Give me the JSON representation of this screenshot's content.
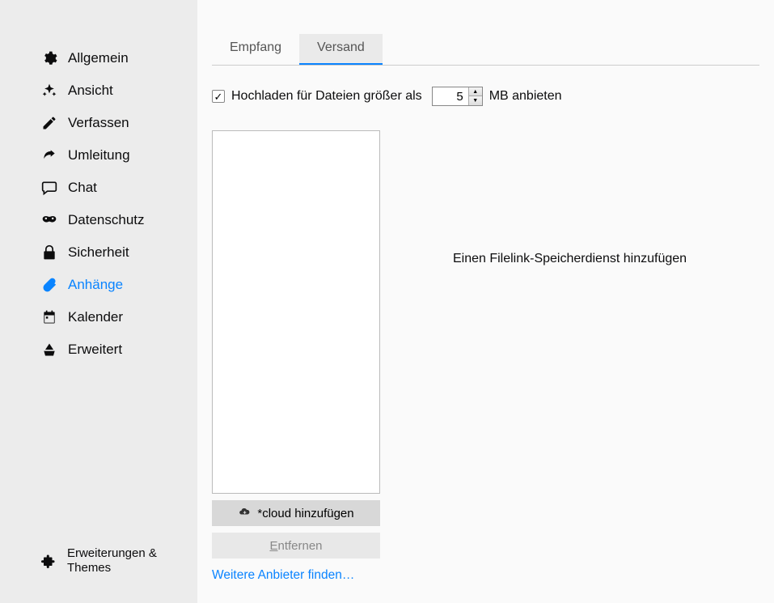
{
  "sidebar": {
    "items": [
      {
        "label": "Allgemein",
        "icon": "gear"
      },
      {
        "label": "Ansicht",
        "icon": "sparkle"
      },
      {
        "label": "Verfassen",
        "icon": "pencil"
      },
      {
        "label": "Umleitung",
        "icon": "redirect"
      },
      {
        "label": "Chat",
        "icon": "chat"
      },
      {
        "label": "Datenschutz",
        "icon": "mask"
      },
      {
        "label": "Sicherheit",
        "icon": "lock"
      },
      {
        "label": "Anhänge",
        "icon": "paperclip",
        "active": true
      },
      {
        "label": "Kalender",
        "icon": "calendar"
      },
      {
        "label": "Erweitert",
        "icon": "wizard"
      }
    ],
    "bottom": {
      "label": "Erweiterungen & Themes",
      "icon": "puzzle"
    }
  },
  "tabs": [
    {
      "label": "Empfang"
    },
    {
      "label": "Versand",
      "active": true
    }
  ],
  "upload": {
    "checked": true,
    "prefix": "Hochladen für Dateien größer als",
    "value": "5",
    "suffix": "MB anbieten"
  },
  "buttons": {
    "add_cloud": "*cloud hinzufügen",
    "remove": "Entfernen",
    "remove_ul": "E",
    "remove_rest": "ntfernen"
  },
  "link": {
    "find_more": "Weitere Anbieter finden…"
  },
  "message": {
    "add_filelink": "Einen Filelink-Speicherdienst hinzufügen"
  }
}
